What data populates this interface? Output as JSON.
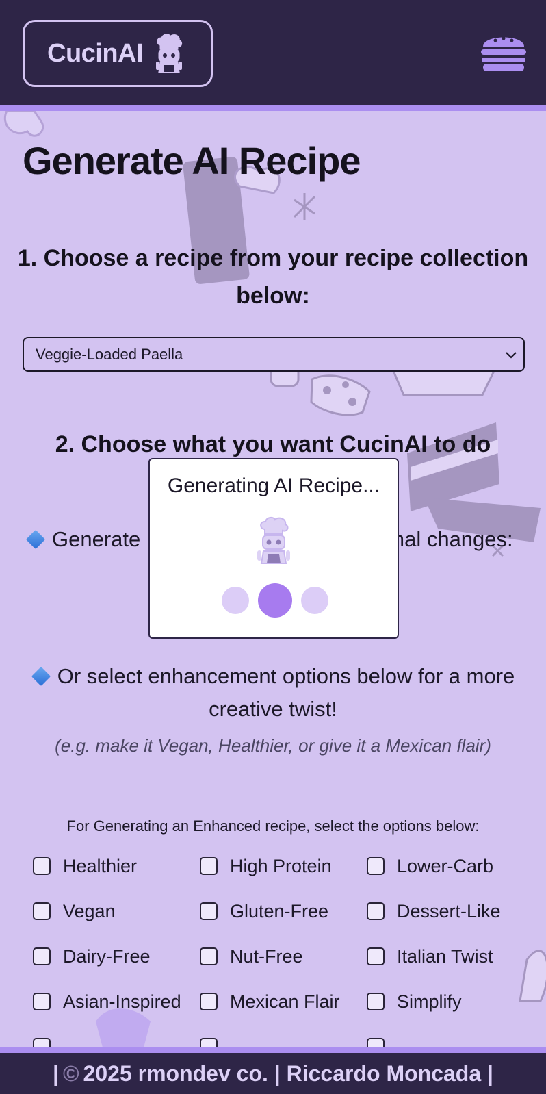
{
  "header": {
    "brand": "CucinAI",
    "logo_icon": "chef-robot-icon",
    "menu_icon": "burger-menu-icon"
  },
  "page": {
    "title": "Generate AI Recipe",
    "step1": "1. Choose a recipe from your recipe collection below:",
    "recipe_select": {
      "selected": "Veggie-Loaded Paella"
    },
    "step2": "2. Choose what you want CucinAI to do",
    "generate_line": {
      "prefix": "Generate",
      "suffix": "mal changes:"
    },
    "enhance_line": "Or select enhancement options below for a more creative twist!",
    "hint": "(e.g. make it Vegan, Healthier, or give it a Mexican flair)",
    "options_header": "For Generating an Enhanced recipe, select the options below:",
    "options": [
      {
        "label": "Healthier",
        "checked": false
      },
      {
        "label": "High Protein",
        "checked": false
      },
      {
        "label": "Lower-Carb",
        "checked": false
      },
      {
        "label": "Vegan",
        "checked": false
      },
      {
        "label": "Gluten-Free",
        "checked": false
      },
      {
        "label": "Dessert-Like",
        "checked": false
      },
      {
        "label": "Dairy-Free",
        "checked": false
      },
      {
        "label": "Nut-Free",
        "checked": false
      },
      {
        "label": "Italian Twist",
        "checked": false
      },
      {
        "label": "Asian-Inspired",
        "checked": false
      },
      {
        "label": "Mexican Flair",
        "checked": false
      },
      {
        "label": "Simplify",
        "checked": false
      }
    ]
  },
  "modal": {
    "title": "Generating AI Recipe...",
    "icon": "chef-robot-icon"
  },
  "footer": {
    "prefix": "|",
    "copyright_symbol": "©",
    "text": "2025 rmondev co. | Riccardo Moncada |"
  },
  "colors": {
    "header_bg": "#2e2547",
    "accent": "#ab8ef0",
    "page_bg": "#d3c3f1",
    "loader_active": "#a77bef"
  }
}
